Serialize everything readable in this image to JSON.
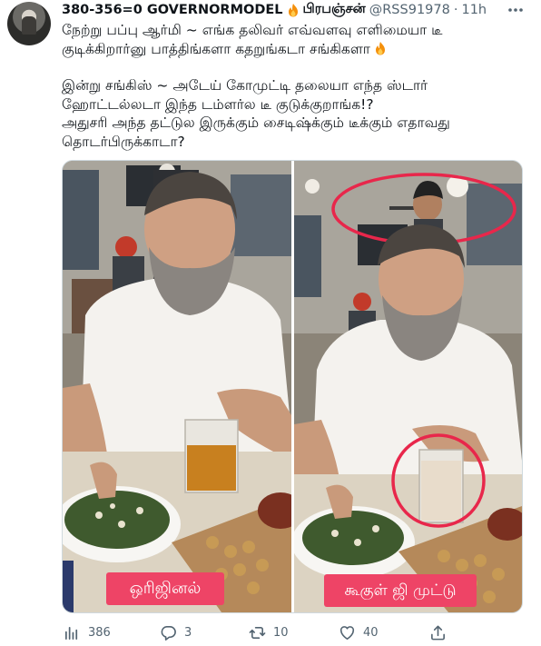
{
  "tweet": {
    "display_name": "380-356=0 GOVERNORMODEL",
    "name_suffix": "பிரபஞ்சன்",
    "handle": "@RSS91978",
    "separator": "·",
    "time": "11h",
    "more_icon": "more-horizontal-icon",
    "text_lines": [
      "நேற்று பப்பு ஆர்மி ~ எங்க தலிவர் எவ்வளவு எளிமையா டீ",
      "குடிக்கிறார்னு பாத்திங்களா கதறுங்கடா சங்கிகளா",
      "இன்று சங்கிஸ் ~ அடேய் கோமுட்டி தலையா எந்த ஸ்டார்",
      "ஹோட்டல்லடா இந்த டம்ளர்ல டீ குடுக்குறாங்க!?",
      "அதுசரி அந்த தட்டுல இருக்கும் சைடிஷ்க்கும் டீக்கும் எதாவது",
      "தொடர்பிருக்காடா?"
    ],
    "media": {
      "left_caption": "ஒரிஜினல்",
      "right_caption": "கூகுள் ஜி முட்டு"
    },
    "metrics": {
      "views": "386",
      "replies": "3",
      "retweets": "10",
      "likes": "40"
    }
  },
  "colors": {
    "accent_red": "#e8274b",
    "caption_bg": "#ee4466",
    "muted": "#536471"
  }
}
